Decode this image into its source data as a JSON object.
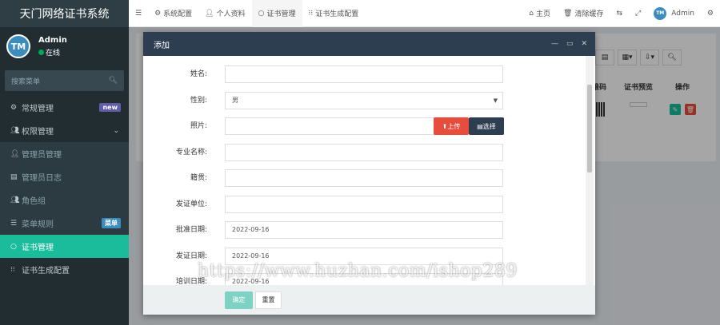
{
  "app": {
    "title": "天门网络证书系统"
  },
  "user": {
    "name": "Admin",
    "status": "在线",
    "avatar_text": "T‑M"
  },
  "sidebar": {
    "search_placeholder": "搜索菜单",
    "items": [
      {
        "label": "常规管理",
        "icon": "gears-icon",
        "badge": "new"
      },
      {
        "label": "权限管理",
        "icon": "users-icon"
      },
      {
        "label": "管理员管理",
        "icon": "user-icon"
      },
      {
        "label": "管理员日志",
        "icon": "list-icon"
      },
      {
        "label": "角色组",
        "icon": "group-icon"
      },
      {
        "label": "菜单规则",
        "icon": "bars-icon",
        "badge": "菜单"
      },
      {
        "label": "证书管理",
        "icon": "circle-icon"
      },
      {
        "label": "证书生成配置",
        "icon": "grid-icon"
      }
    ]
  },
  "header": {
    "tabs": [
      {
        "label": "系统配置"
      },
      {
        "label": "个人资料"
      },
      {
        "label": "证书管理"
      },
      {
        "label": "证书生成配置"
      }
    ],
    "home": "主页",
    "clear_cache": "清除缓存",
    "user": "Admin"
  },
  "background_table": {
    "headers": [
      "维码",
      "证书预览",
      "操作"
    ]
  },
  "modal": {
    "title": "添加",
    "fields": [
      {
        "label": "姓名:",
        "value": ""
      },
      {
        "label": "性别:",
        "value": "男"
      },
      {
        "label": "照片:",
        "value": ""
      },
      {
        "label": "专业名称:",
        "value": ""
      },
      {
        "label": "籍贯:",
        "value": ""
      },
      {
        "label": "发证单位:",
        "value": ""
      },
      {
        "label": "批准日期:",
        "value": "2022-09-16"
      },
      {
        "label": "发证日期:",
        "value": "2022-09-16"
      },
      {
        "label": "培训日期:",
        "value": "2022-09-16"
      }
    ],
    "upload_label": "上传",
    "select_label": "选择",
    "ok_label": "确定",
    "reset_label": "重置"
  },
  "watermark": "https://www.huzhan.com/ishop289",
  "colors": {
    "sidebar": "#222d32",
    "active": "#1abc9c",
    "modal_header": "#2c3e50",
    "danger": "#e74c3c"
  }
}
